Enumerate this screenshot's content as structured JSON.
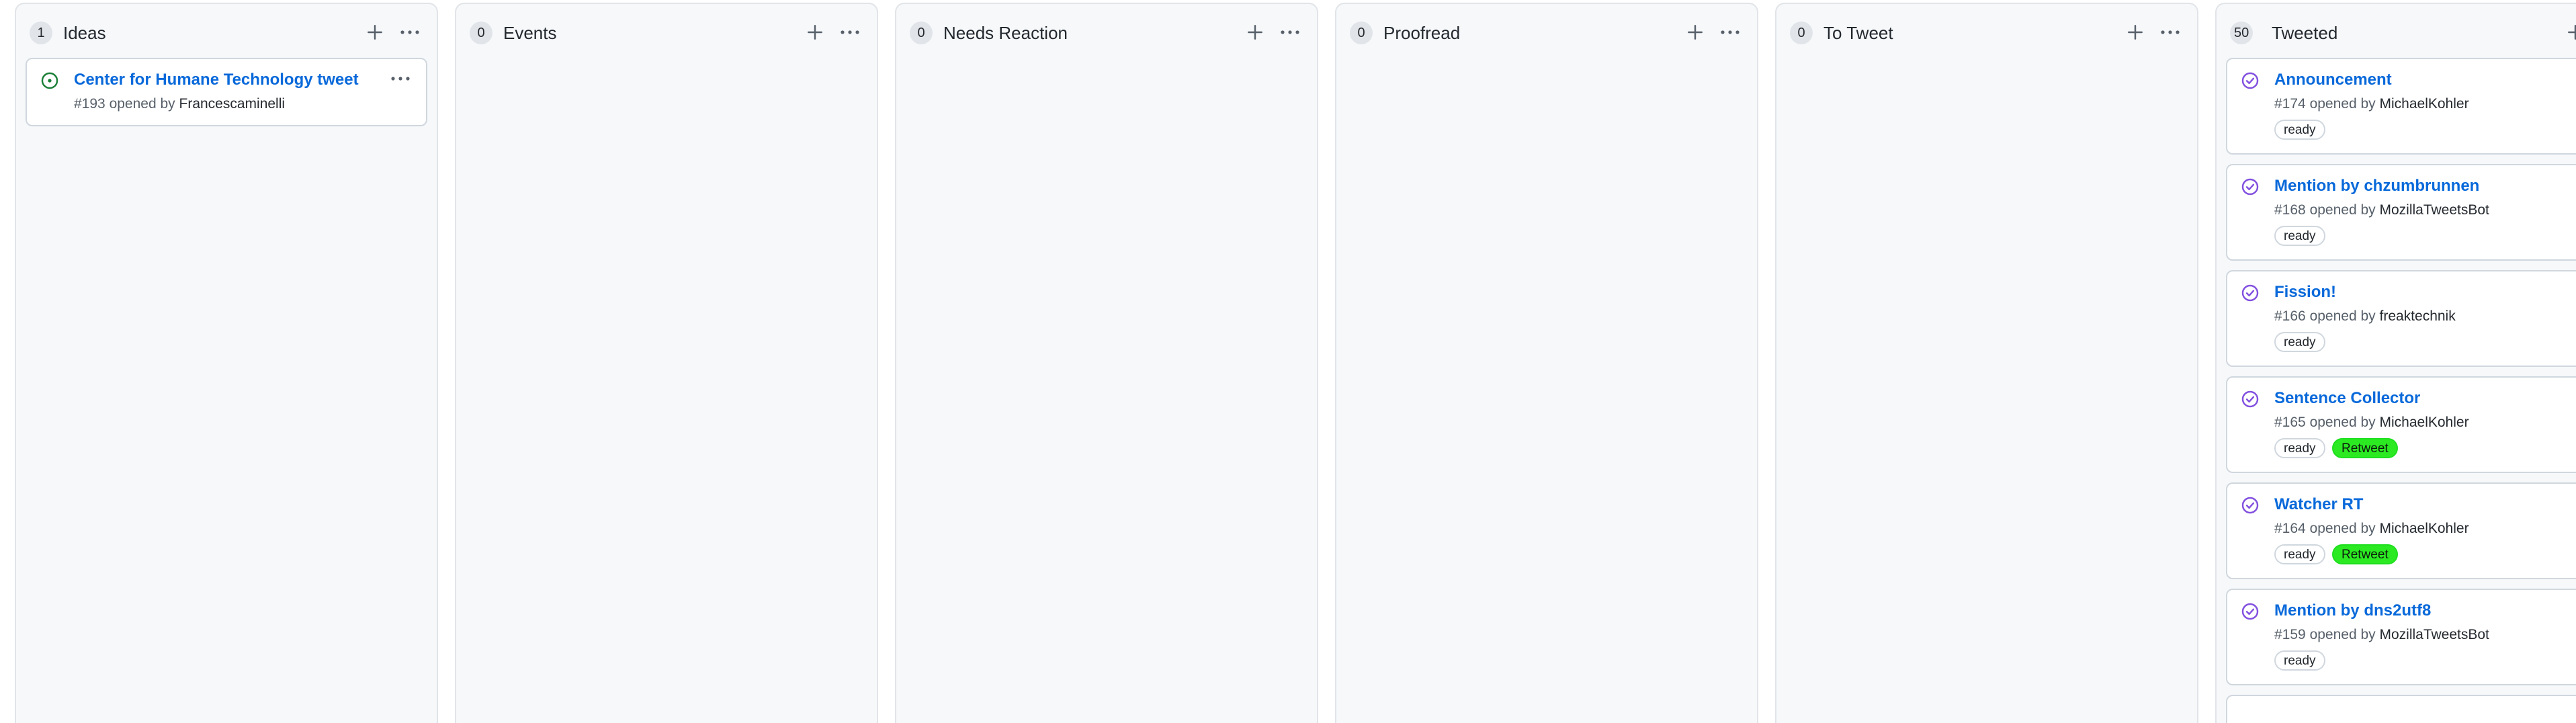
{
  "columns": [
    {
      "title": "Ideas",
      "count": "1",
      "add_icon": "plus-icon",
      "menu_icon": "kebab-horizontal-icon",
      "cards": [
        {
          "title": "Center for Humane Technology tweet",
          "number": "#193",
          "opened_by_text": "opened by",
          "author": "Francescaminelli",
          "status_icon": "issue-opened-icon",
          "labels": []
        }
      ]
    },
    {
      "title": "Events",
      "count": "0",
      "add_icon": "plus-icon",
      "menu_icon": "kebab-horizontal-icon",
      "cards": []
    },
    {
      "title": "Needs Reaction",
      "count": "0",
      "add_icon": "plus-icon",
      "menu_icon": "kebab-horizontal-icon",
      "cards": []
    },
    {
      "title": "Proofread",
      "count": "0",
      "add_icon": "plus-icon",
      "menu_icon": "kebab-horizontal-icon",
      "cards": []
    },
    {
      "title": "To Tweet",
      "count": "0",
      "add_icon": "plus-icon",
      "menu_icon": "kebab-horizontal-icon",
      "cards": []
    },
    {
      "title": "Tweeted",
      "count": "50",
      "add_icon": "plus-icon",
      "menu_icon": "kebab-horizontal-icon",
      "cards": [
        {
          "title": "Announcement",
          "number": "#174",
          "opened_by_text": "opened by",
          "author": "MichaelKohler",
          "status_icon": "issue-closed-icon",
          "labels": [
            "ready"
          ]
        },
        {
          "title": "Mention by chzumbrunnen",
          "number": "#168",
          "opened_by_text": "opened by",
          "author": "MozillaTweetsBot",
          "status_icon": "issue-closed-icon",
          "labels": [
            "ready"
          ]
        },
        {
          "title": "Fission!",
          "number": "#166",
          "opened_by_text": "opened by",
          "author": "freaktechnik",
          "status_icon": "issue-closed-icon",
          "labels": [
            "ready"
          ]
        },
        {
          "title": "Sentence Collector",
          "number": "#165",
          "opened_by_text": "opened by",
          "author": "MichaelKohler",
          "status_icon": "issue-closed-icon",
          "labels": [
            "ready",
            "Retweet"
          ]
        },
        {
          "title": "Watcher RT",
          "number": "#164",
          "opened_by_text": "opened by",
          "author": "MichaelKohler",
          "status_icon": "issue-closed-icon",
          "labels": [
            "ready",
            "Retweet"
          ]
        },
        {
          "title": "Mention by dns2utf8",
          "number": "#159",
          "opened_by_text": "opened by",
          "author": "MozillaTweetsBot",
          "status_icon": "issue-closed-icon",
          "labels": [
            "ready"
          ]
        }
      ]
    }
  ],
  "colors": {
    "link": "#0969da",
    "open_issue": "#1a7f37",
    "closed_issue": "#8250df",
    "retweet_label": "#2bea22",
    "column_bg": "#f6f8fa"
  }
}
